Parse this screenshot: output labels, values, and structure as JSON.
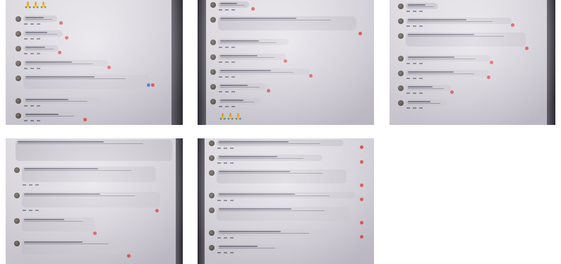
{
  "gallery": {
    "photo_count": 5,
    "columns": 3
  },
  "photos": [
    {
      "emoji_top": "🙏🙏🙏"
    },
    {
      "emoji_bottom": "🙏🙏🙏"
    },
    {},
    {},
    {}
  ],
  "colors": {
    "background": "#ffffff",
    "screen_tint": "#dcd9e2",
    "comment_bubble": "#d3d0d8",
    "reaction_heart": "#e2534f",
    "reaction_like": "#4a7be3"
  }
}
